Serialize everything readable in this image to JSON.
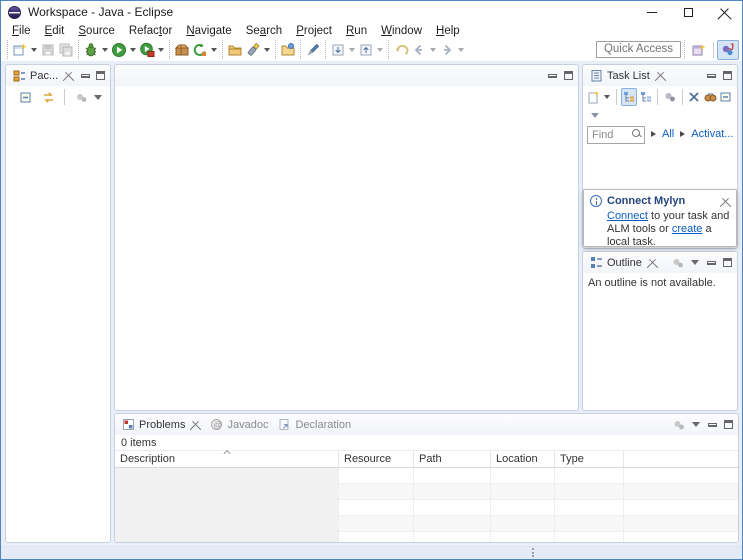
{
  "window": {
    "title": "Workspace - Java - Eclipse"
  },
  "menu": {
    "items": [
      {
        "pre": "",
        "key": "F",
        "post": "ile"
      },
      {
        "pre": "",
        "key": "E",
        "post": "dit"
      },
      {
        "pre": "",
        "key": "S",
        "post": "ource"
      },
      {
        "pre": "Refac",
        "key": "t",
        "post": "or"
      },
      {
        "pre": "",
        "key": "N",
        "post": "avigate"
      },
      {
        "pre": "Se",
        "key": "a",
        "post": "rch"
      },
      {
        "pre": "",
        "key": "P",
        "post": "roject"
      },
      {
        "pre": "",
        "key": "R",
        "post": "un"
      },
      {
        "pre": "",
        "key": "W",
        "post": "indow"
      },
      {
        "pre": "",
        "key": "H",
        "post": "elp"
      }
    ]
  },
  "toolbar": {
    "quick_access": "Quick Access"
  },
  "package_explorer": {
    "tab_label": "Pac..."
  },
  "task_list": {
    "tab_label": "Task List",
    "find_placeholder": "Find",
    "all_label": "All",
    "activate_label": "Activat...",
    "trailing_paren": "("
  },
  "mylyn_popup": {
    "title": "Connect Mylyn",
    "link_connect": "Connect",
    "text_mid": " to your task and ALM tools or ",
    "link_create": "create",
    "text_end": " a local task."
  },
  "outline": {
    "tab_label": "Outline",
    "message": "An outline is not available."
  },
  "problems": {
    "tab_problems": "Problems",
    "tab_javadoc": "Javadoc",
    "tab_declaration": "Declaration",
    "status": "0 items",
    "columns": [
      "Description",
      "Resource",
      "Path",
      "Location",
      "Type"
    ]
  },
  "glyphs": {
    "at": "@",
    "java": "J"
  },
  "colors": {
    "window_border": "#4e86c4",
    "link_blue": "#0b5cc4",
    "selection_blue": "#d5e5f6"
  }
}
